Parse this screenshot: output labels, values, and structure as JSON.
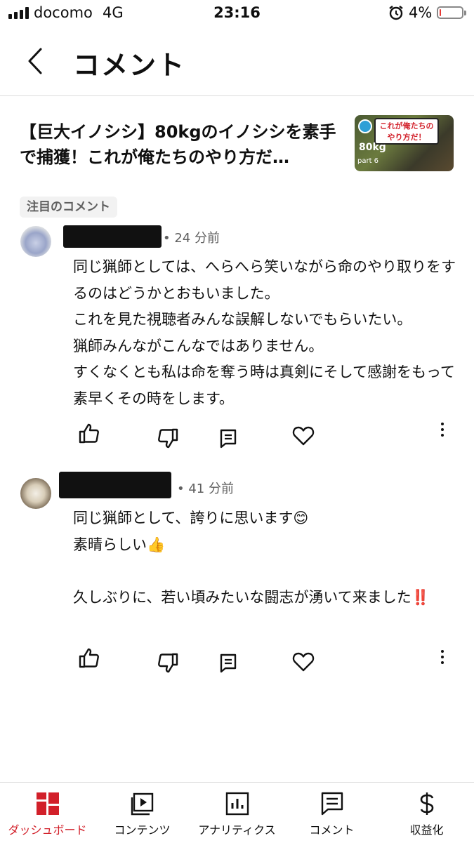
{
  "status_bar": {
    "carrier": "docomo",
    "network": "4G",
    "time": "23:16",
    "battery_percent": "4%",
    "battery_level": 0.04,
    "battery_color": "#e53935"
  },
  "header": {
    "title": "コメント",
    "back_icon": "chevron-left-icon"
  },
  "video": {
    "title": "【巨大イノシシ】80kgのイノシシを素手で捕獲！これが俺たちのやり方だ…",
    "thumbnail": {
      "badge_line1": "これが俺たちの",
      "badge_line2": "やり方だ！",
      "weight": "80kg",
      "part": "part 6"
    }
  },
  "section_chip": "注目のコメント",
  "comments": [
    {
      "time": "• 24 分前",
      "text": "同じ猟師としては、へらへら笑いながら命のやり取りをするのはどうかとおもいました。\nこれを見た視聴者みんな誤解しないでもらいたい。\n猟師みんながこんなではありません。\nすくなくとも私は命を奪う時は真剣にそして感謝をもって素早くその時をします。"
    },
    {
      "time": "• 41 分前",
      "text": "同じ猟師として、誇りに思います😊\n素晴らしい👍\n\n久しぶりに、若い頃みたいな闘志が湧いて来ました‼️"
    }
  ],
  "bottom_nav": [
    {
      "label": "ダッシュボード",
      "icon": "dashboard-icon",
      "active": true
    },
    {
      "label": "コンテンツ",
      "icon": "content-icon",
      "active": false
    },
    {
      "label": "アナリティクス",
      "icon": "analytics-icon",
      "active": false
    },
    {
      "label": "コメント",
      "icon": "comments-icon",
      "active": false
    },
    {
      "label": "収益化",
      "icon": "dollar-icon",
      "active": false
    }
  ],
  "colors": {
    "accent": "#d2202a",
    "secondary_text": "#606060"
  }
}
